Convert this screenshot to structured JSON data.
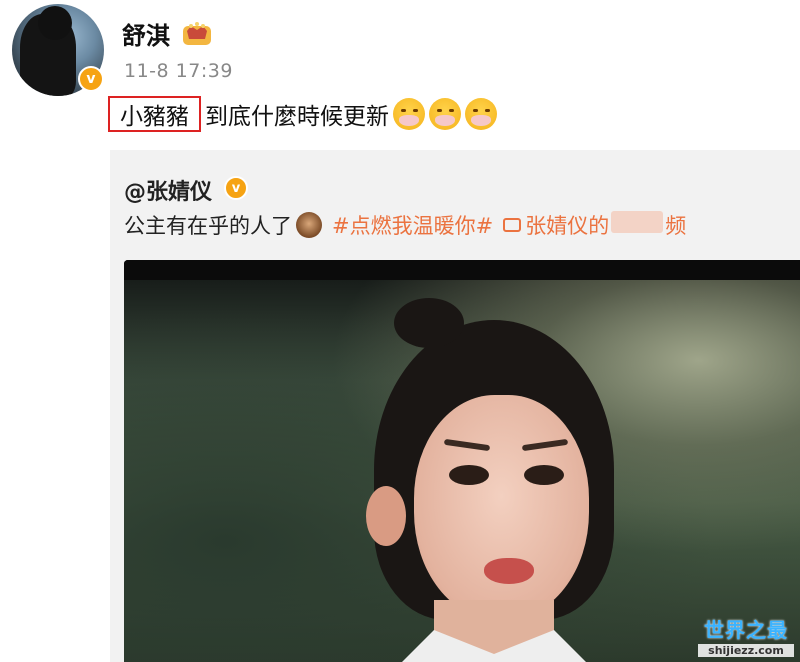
{
  "post": {
    "username": "舒淇",
    "timestamp": "11-8 17:39",
    "verified_mark": "v",
    "highlighted_text": "小豬豬",
    "text": "到底什麼時候更新",
    "emoji_count": 3
  },
  "repost": {
    "author": "@张婧仪",
    "verified_mark": "v",
    "text": "公主有在乎的人了",
    "hashtag": "#点燃我温暖你#",
    "video_link_prefix": "张婧仪的",
    "video_link_suffix": "频"
  },
  "watermark": {
    "title": "世界之最",
    "url": "shijiezz.com"
  },
  "icons": {
    "avatar": "user-avatar",
    "crown": "crown-icon",
    "verified": "verified-badge-icon",
    "emoji": "mask-face-emoji-icon",
    "monkey": "see-no-evil-monkey-icon",
    "video": "video-icon"
  },
  "colors": {
    "accent_orange": "#eb7340",
    "verified_yellow": "#f6a313",
    "highlight_red": "#d22222",
    "timestamp_gray": "#888888",
    "repost_bg": "#f2f2f2"
  }
}
